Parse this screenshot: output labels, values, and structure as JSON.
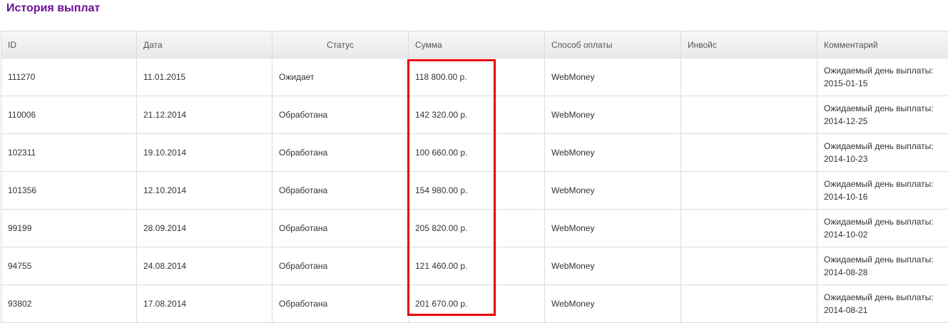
{
  "page": {
    "title": "История выплат"
  },
  "table": {
    "columns": [
      "ID",
      "Дата",
      "Статус",
      "Сумма",
      "Способ оплаты",
      "Инвойс",
      "Комментарий"
    ],
    "rows": [
      {
        "id": "111270",
        "date": "11.01.2015",
        "status": "Ожидает",
        "amount": "118 800.00 р.",
        "method": "WebMoney",
        "invoice": "",
        "comment": "Ожидаемый день выплаты: 2015-01-15"
      },
      {
        "id": "110006",
        "date": "21.12.2014",
        "status": "Обработана",
        "amount": "142 320.00 р.",
        "method": "WebMoney",
        "invoice": "",
        "comment": "Ожидаемый день выплаты: 2014-12-25"
      },
      {
        "id": "102311",
        "date": "19.10.2014",
        "status": "Обработана",
        "amount": "100 660.00 р.",
        "method": "WebMoney",
        "invoice": "",
        "comment": "Ожидаемый день выплаты: 2014-10-23"
      },
      {
        "id": "101356",
        "date": "12.10.2014",
        "status": "Обработана",
        "amount": "154 980.00 р.",
        "method": "WebMoney",
        "invoice": "",
        "comment": "Ожидаемый день выплаты: 2014-10-16"
      },
      {
        "id": "99199",
        "date": "28.09.2014",
        "status": "Обработана",
        "amount": "205 820.00 р.",
        "method": "WebMoney",
        "invoice": "",
        "comment": "Ожидаемый день выплаты: 2014-10-02"
      },
      {
        "id": "94755",
        "date": "24.08.2014",
        "status": "Обработана",
        "amount": "121 460.00 р.",
        "method": "WebMoney",
        "invoice": "",
        "comment": "Ожидаемый день выплаты: 2014-08-28"
      },
      {
        "id": "93802",
        "date": "17.08.2014",
        "status": "Обработана",
        "amount": "201 670.00 р.",
        "method": "WebMoney",
        "invoice": "",
        "comment": "Ожидаемый день выплаты: 2014-08-21"
      }
    ]
  },
  "colors": {
    "title": "#6a0f95",
    "highlight": "#e8000b"
  }
}
